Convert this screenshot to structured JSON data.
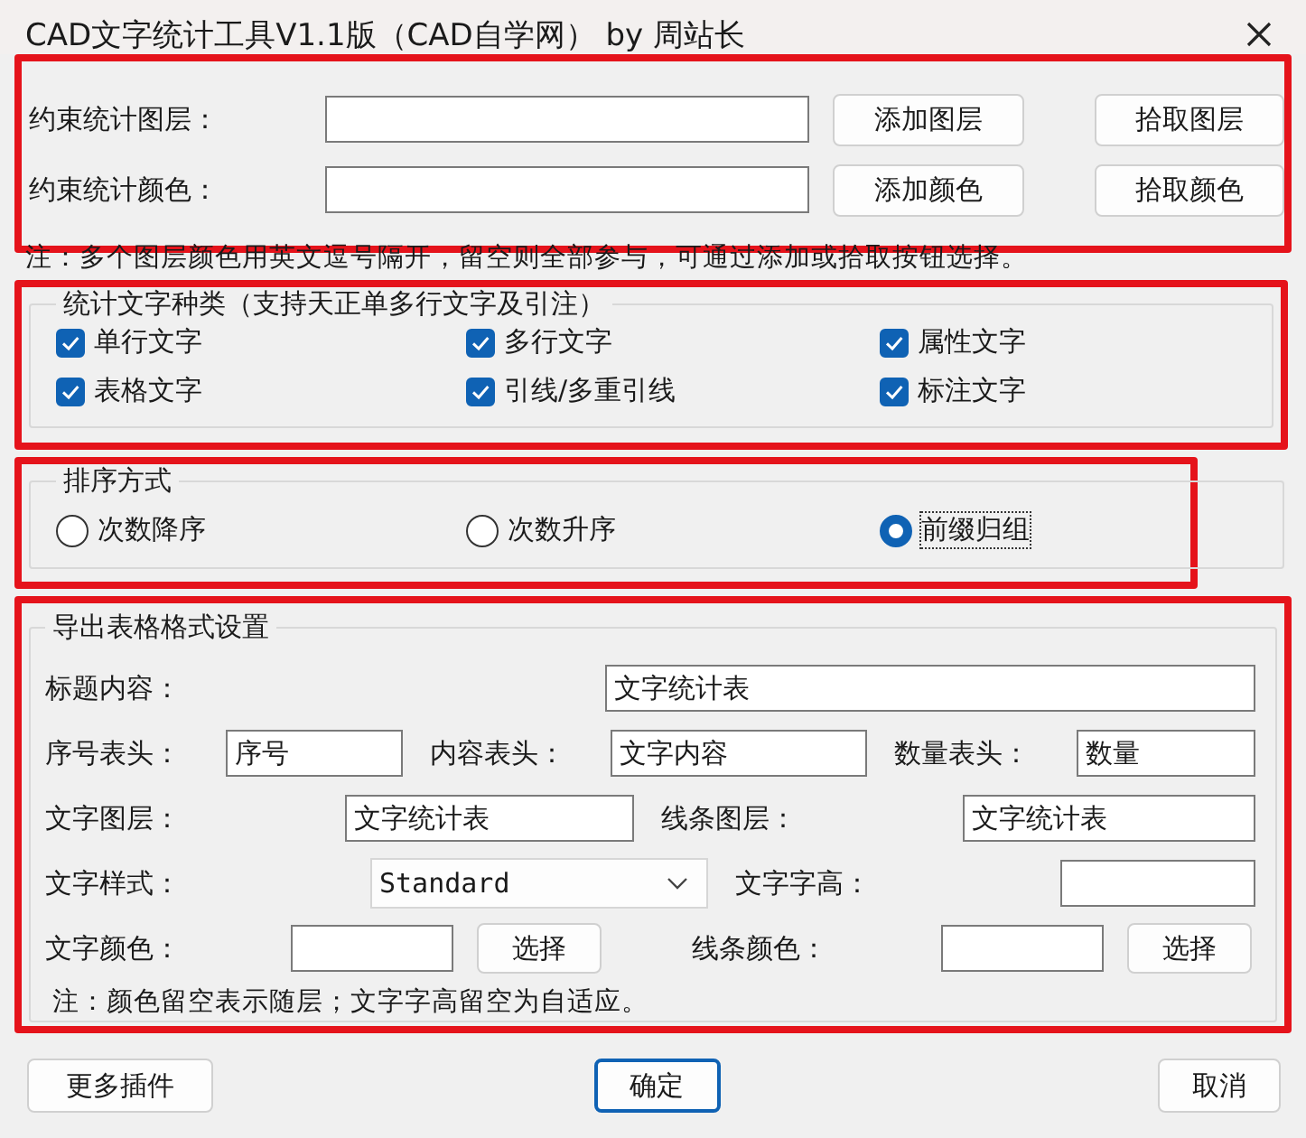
{
  "window": {
    "title": "CAD文字统计工具V1.1版（CAD自学网） by 周站长"
  },
  "filters": [
    {
      "label": "约束统计图层：",
      "buttons": [
        "添加图层",
        "拾取图层"
      ]
    },
    {
      "label": "约束统计颜色：",
      "buttons": [
        "添加颜色",
        "拾取颜色"
      ]
    }
  ],
  "note": "注：多个图层颜色用英文逗号隔开，留空则全部参与，可通过添加或拾取按钮选择。",
  "text_types": {
    "title": "统计文字种类（支持天正单多行文字及引注）",
    "items": [
      {
        "label": "单行文字",
        "checked": true
      },
      {
        "label": "多行文字",
        "checked": true
      },
      {
        "label": "属性文字",
        "checked": true
      },
      {
        "label": "表格文字",
        "checked": true
      },
      {
        "label": "引线/多重引线",
        "checked": true
      },
      {
        "label": "标注文字",
        "checked": true
      }
    ]
  },
  "sort": {
    "title": "排序方式",
    "options": [
      {
        "label": "次数降序",
        "selected": false
      },
      {
        "label": "次数升序",
        "selected": false
      },
      {
        "label": "前缀归组",
        "selected": true
      }
    ]
  },
  "export": {
    "title": "导出表格格式设置",
    "rows": [
      [
        {
          "kind": "label",
          "text": "标题内容："
        },
        {
          "kind": "input",
          "value": "文字统计表"
        }
      ],
      [
        {
          "kind": "label",
          "text": "序号表头："
        },
        {
          "kind": "input",
          "value": "序号"
        },
        {
          "kind": "label",
          "text": "内容表头："
        },
        {
          "kind": "input",
          "value": "文字内容"
        },
        {
          "kind": "label",
          "text": "数量表头："
        },
        {
          "kind": "input",
          "value": "数量"
        }
      ],
      [
        {
          "kind": "label",
          "text": "文字图层："
        },
        {
          "kind": "input",
          "value": "文字统计表"
        },
        {
          "kind": "label",
          "text": "线条图层："
        },
        {
          "kind": "input",
          "value": "文字统计表"
        }
      ],
      [
        {
          "kind": "label",
          "text": "文字样式："
        },
        {
          "kind": "select",
          "value": "Standard"
        },
        {
          "kind": "label",
          "text": "文字字高："
        },
        {
          "kind": "input"
        }
      ],
      [
        {
          "kind": "label",
          "text": "文字颜色："
        },
        {
          "kind": "input"
        },
        {
          "kind": "button",
          "text": "选择"
        },
        {
          "kind": "label",
          "text": "线条颜色："
        },
        {
          "kind": "input"
        },
        {
          "kind": "button",
          "text": "选择"
        }
      ]
    ],
    "note": "注：颜色留空表示随层；文字字高留空为自适应。"
  },
  "buttons": [
    {
      "label": "更多插件",
      "default": false
    },
    {
      "label": "确定",
      "default": true
    },
    {
      "label": "取消",
      "default": false
    }
  ]
}
